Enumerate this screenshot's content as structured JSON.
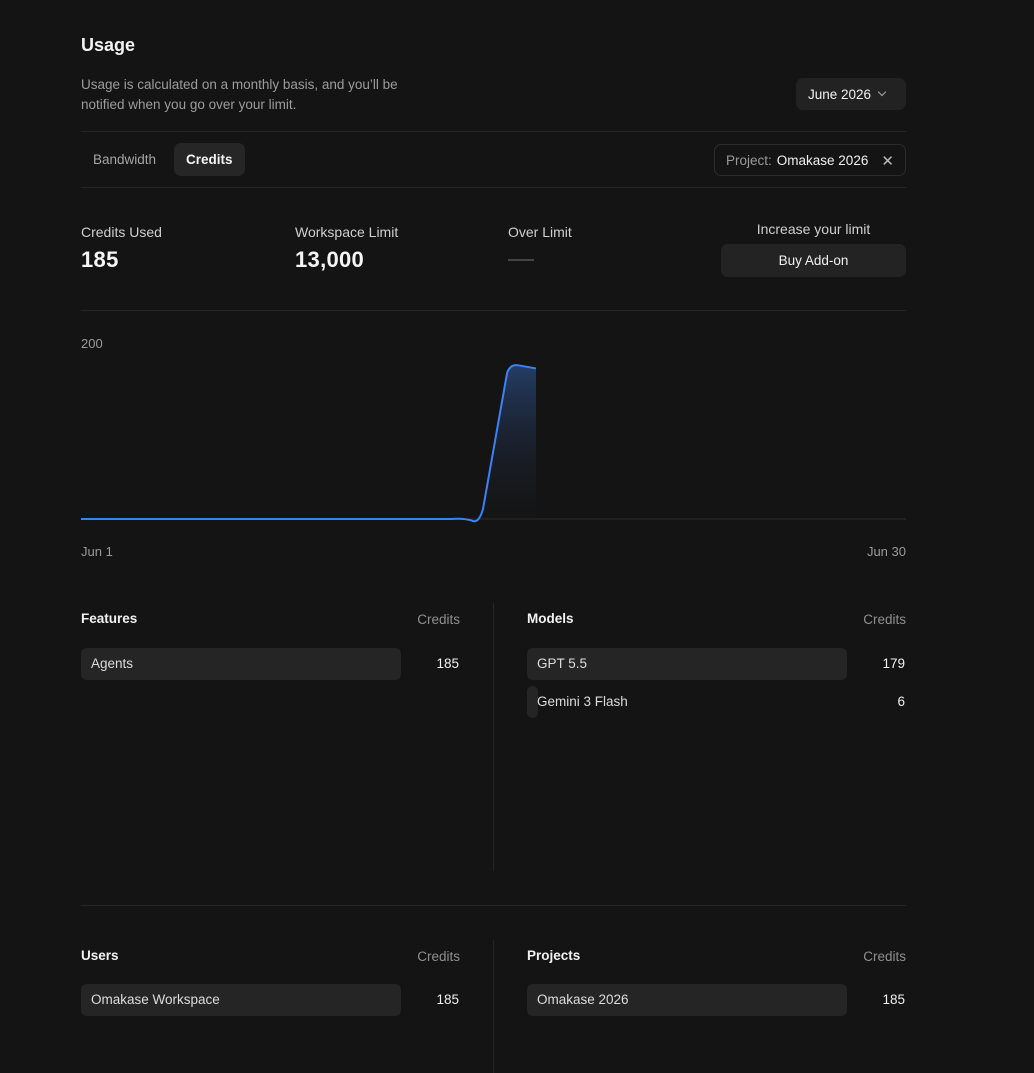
{
  "header": {
    "title": "Usage",
    "description": "Usage is calculated on a monthly basis, and you’ll be notified when you go over your limit.",
    "month": "June 2026"
  },
  "tabs": [
    {
      "label": "Bandwidth",
      "active": false
    },
    {
      "label": "Credits",
      "active": true
    }
  ],
  "filter": {
    "label": "Project:",
    "value": "Omakase 2026"
  },
  "stats": {
    "credits_used_label": "Credits Used",
    "credits_used_value": "185",
    "workspace_limit_label": "Workspace Limit",
    "workspace_limit_value": "13,000",
    "over_limit_label": "Over Limit",
    "increase_label": "Increase your limit",
    "buy_label": "Buy Add-on"
  },
  "chart_data": {
    "type": "area",
    "y_tick": "200",
    "x_start_label": "Jun 1",
    "x_end_label": "Jun 30",
    "ylim": [
      0,
      200
    ],
    "x": [
      1,
      2,
      3,
      4,
      5,
      6,
      7,
      8,
      9,
      10,
      11,
      12,
      13,
      14,
      15,
      16,
      17
    ],
    "values": [
      0,
      0,
      0,
      0,
      0,
      0,
      0,
      0,
      0,
      0,
      0,
      0,
      0,
      0,
      0,
      185,
      185
    ],
    "line_color": "#3b82f6"
  },
  "features": {
    "title": "Features",
    "col": "Credits",
    "rows": [
      {
        "name": "Agents",
        "value": 185,
        "fraction": 1.0
      }
    ]
  },
  "models": {
    "title": "Models",
    "col": "Credits",
    "rows": [
      {
        "name": "GPT 5.5",
        "value": 179,
        "fraction": 1.0
      },
      {
        "name": "Gemini 3 Flash",
        "value": 6,
        "fraction": 0.034
      }
    ]
  },
  "users": {
    "title": "Users",
    "col": "Credits",
    "rows": [
      {
        "name": "Omakase Workspace",
        "value": 185,
        "fraction": 1.0
      }
    ]
  },
  "projects": {
    "title": "Projects",
    "col": "Credits",
    "rows": [
      {
        "name": "Omakase 2026",
        "value": 185,
        "fraction": 1.0
      }
    ]
  }
}
